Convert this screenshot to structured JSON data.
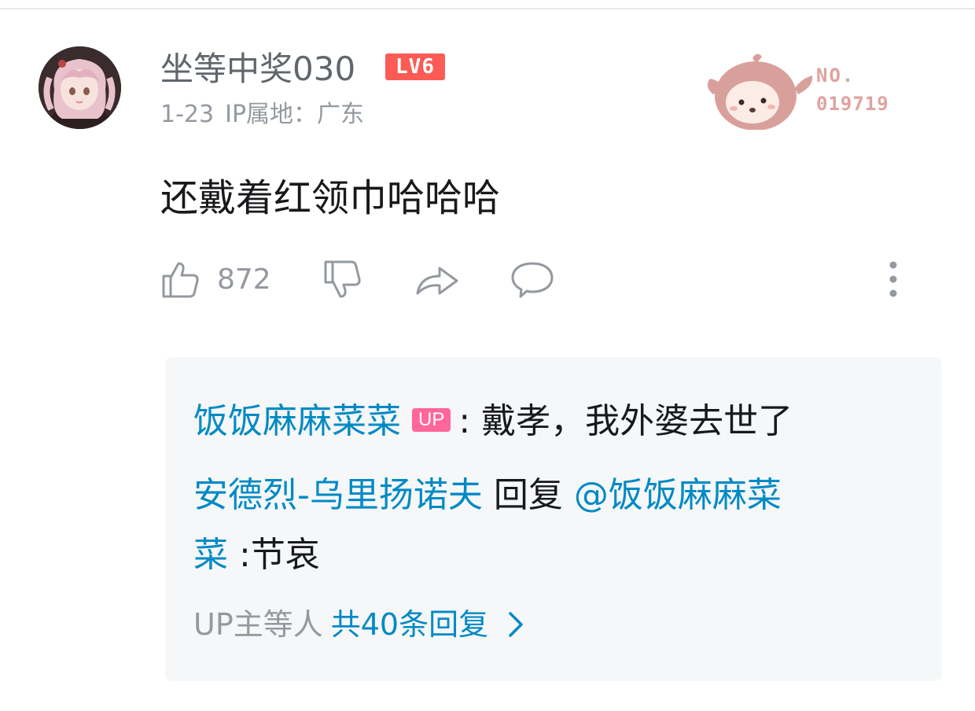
{
  "comment": {
    "username": "坐等中奖030",
    "level_badge": "LV6",
    "date": "1-23",
    "ip_location": "IP属地：广东",
    "fan_badge": {
      "no_label": "NO.",
      "number": "019719"
    },
    "text": "还戴着红领巾哈哈哈",
    "actions": {
      "like_count": "872"
    }
  },
  "replies": {
    "reply1": {
      "author": "饭饭麻麻菜菜",
      "up_tag": "UP",
      "sep": ":",
      "text": "戴孝，我外婆去世了"
    },
    "reply2": {
      "author": "安德烈-乌里扬诺夫",
      "reply_word": "回复",
      "mention_line1": "@饭饭麻麻菜",
      "mention_line2": "菜",
      "sep": ":",
      "text": "节哀"
    },
    "footer": {
      "prefix": "UP主等人",
      "total": "共40条回复"
    }
  },
  "colors": {
    "accent_blue": "#008ac5",
    "level_red": "#fb5b55",
    "up_pink": "#ff6699",
    "fan_badge": "#dfa39e"
  },
  "icons": [
    "thumbs-up-icon",
    "thumbs-down-icon",
    "share-icon",
    "reply-icon",
    "more-vertical-icon",
    "chevron-right-icon"
  ]
}
